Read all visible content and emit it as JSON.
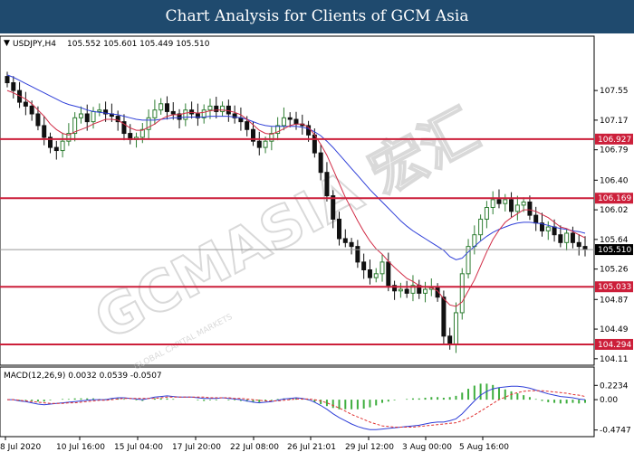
{
  "banner": {
    "title": "Chart Analysis for Clients of GCM Asia"
  },
  "watermark": {
    "text": "GCMASIA 宏汇",
    "subtext": "GLOBAL CAPITAL MARKETS",
    "color": "#cfcfcf"
  },
  "chart_data": [
    {
      "type": "candlestick",
      "symbol_label": "USDJPY,H4",
      "ohlc_label": "105.552 105.601 105.449 105.510",
      "ylim": [
        104.05,
        108.05
      ],
      "y_ticks": [
        107.55,
        107.17,
        106.79,
        106.4,
        106.02,
        105.64,
        105.26,
        104.87,
        104.49,
        104.11
      ],
      "x_ticks": [
        "8 Jul 2020",
        "10 Jul 16:00",
        "15 Jul 04:00",
        "17 Jul 20:00",
        "22 Jul 08:00",
        "26 Jul 21:01",
        "29 Jul 12:00",
        "3 Aug 00:00",
        "5 Aug 16:00"
      ],
      "levels": [
        {
          "value": 106.927,
          "label": "106.927"
        },
        {
          "value": 106.169,
          "label": "106.169"
        },
        {
          "value": 105.033,
          "label": "105.033"
        },
        {
          "value": 104.294,
          "label": "104.294"
        }
      ],
      "current_price": {
        "value": 105.51,
        "label": "105.510"
      },
      "colors": {
        "up": "#2e7d32",
        "down": "#111111",
        "level": "#cc1f3a",
        "ma_fast": "#d12b45",
        "ma_slow": "#2f3fd8",
        "current": "#999999"
      },
      "close": [
        107.65,
        107.55,
        107.4,
        107.35,
        107.25,
        107.1,
        106.95,
        106.82,
        106.78,
        106.9,
        107.0,
        107.2,
        107.25,
        107.15,
        107.28,
        107.3,
        107.25,
        107.22,
        107.15,
        107.0,
        106.92,
        106.95,
        107.05,
        107.2,
        107.3,
        107.38,
        107.28,
        107.25,
        107.18,
        107.3,
        107.25,
        107.2,
        107.3,
        107.35,
        107.28,
        107.35,
        107.25,
        107.2,
        107.15,
        107.05,
        106.9,
        106.82,
        106.9,
        107.0,
        107.1,
        107.2,
        107.18,
        107.12,
        107.1,
        106.98,
        106.75,
        106.5,
        106.2,
        105.9,
        105.65,
        105.6,
        105.55,
        105.35,
        105.25,
        105.15,
        105.2,
        105.35,
        105.05,
        104.98,
        105.0,
        104.95,
        105.05,
        104.95,
        105.0,
        105.02,
        104.9,
        104.4,
        104.3,
        104.7,
        105.2,
        105.55,
        105.7,
        105.9,
        106.05,
        106.15,
        106.1,
        106.15,
        106.0,
        106.08,
        106.12,
        105.95,
        105.85,
        105.75,
        105.8,
        105.7,
        105.6,
        105.72,
        105.6,
        105.55,
        105.51
      ],
      "ma_fast": [
        107.55,
        107.52,
        107.48,
        107.44,
        107.38,
        107.3,
        107.22,
        107.12,
        107.05,
        107.0,
        106.98,
        107.02,
        107.05,
        107.08,
        107.12,
        107.15,
        107.18,
        107.18,
        107.17,
        107.12,
        107.07,
        107.04,
        107.04,
        107.08,
        107.12,
        107.18,
        107.22,
        107.24,
        107.24,
        107.26,
        107.27,
        107.26,
        107.27,
        107.29,
        107.3,
        107.3,
        107.29,
        107.27,
        107.24,
        107.18,
        107.11,
        107.04,
        107.0,
        106.99,
        107.02,
        107.06,
        107.1,
        107.12,
        107.12,
        107.08,
        106.98,
        106.86,
        106.72,
        106.54,
        106.36,
        106.18,
        106.03,
        105.88,
        105.74,
        105.62,
        105.52,
        105.45,
        105.36,
        105.28,
        105.21,
        105.14,
        105.1,
        105.05,
        105.03,
        105.02,
        104.98,
        104.88,
        104.8,
        104.78,
        104.84,
        104.98,
        105.12,
        105.3,
        105.48,
        105.64,
        105.76,
        105.86,
        105.92,
        105.97,
        106.02,
        106.02,
        106.0,
        105.96,
        105.92,
        105.86,
        105.8,
        105.78,
        105.74,
        105.7,
        105.66
      ],
      "ma_slow": [
        107.75,
        107.72,
        107.68,
        107.64,
        107.6,
        107.56,
        107.52,
        107.48,
        107.44,
        107.4,
        107.37,
        107.35,
        107.33,
        107.3,
        107.28,
        107.27,
        107.26,
        107.25,
        107.24,
        107.22,
        107.2,
        107.18,
        107.17,
        107.17,
        107.17,
        107.18,
        107.19,
        107.2,
        107.2,
        107.21,
        107.21,
        107.21,
        107.21,
        107.22,
        107.22,
        107.22,
        107.22,
        107.21,
        107.2,
        107.18,
        107.15,
        107.12,
        107.1,
        107.09,
        107.09,
        107.09,
        107.09,
        107.09,
        107.08,
        107.06,
        107.02,
        106.97,
        106.9,
        106.82,
        106.73,
        106.64,
        106.55,
        106.46,
        106.37,
        106.28,
        106.2,
        106.12,
        106.04,
        105.96,
        105.88,
        105.81,
        105.75,
        105.7,
        105.65,
        105.6,
        105.55,
        105.5,
        105.42,
        105.38,
        105.4,
        105.48,
        105.55,
        105.62,
        105.68,
        105.73,
        105.77,
        105.8,
        105.83,
        105.85,
        105.86,
        105.86,
        105.85,
        105.84,
        105.82,
        105.8,
        105.78,
        105.77,
        105.75,
        105.74,
        105.72
      ]
    },
    {
      "type": "macd",
      "label": "MACD(12,26,9) 0.0032 0.0539 -0.0507",
      "ylim": [
        -0.55,
        0.27
      ],
      "y_ticks": [
        {
          "value": 0.2234,
          "label": "0.2234"
        },
        {
          "value": 0.0,
          "label": "0.00"
        },
        {
          "value": -0.4747,
          "label": "-0.4747"
        }
      ],
      "colors": {
        "hist": "#3fae3f",
        "macd": "#2f3fd8",
        "signal": "#e03030"
      },
      "macd": [
        0.0,
        0.0,
        -0.02,
        -0.03,
        -0.05,
        -0.07,
        -0.08,
        -0.07,
        -0.06,
        -0.05,
        -0.04,
        -0.03,
        -0.02,
        -0.01,
        0.0,
        0.0,
        0.0,
        0.02,
        0.03,
        0.03,
        0.02,
        0.01,
        0.0,
        0.02,
        0.04,
        0.05,
        0.06,
        0.05,
        0.04,
        0.04,
        0.04,
        0.03,
        0.02,
        0.02,
        0.02,
        0.03,
        0.02,
        0.01,
        0.0,
        -0.02,
        -0.04,
        -0.05,
        -0.04,
        -0.03,
        -0.01,
        0.01,
        0.02,
        0.03,
        0.02,
        0.0,
        -0.04,
        -0.09,
        -0.15,
        -0.22,
        -0.28,
        -0.33,
        -0.38,
        -0.42,
        -0.45,
        -0.47,
        -0.47,
        -0.46,
        -0.45,
        -0.44,
        -0.43,
        -0.42,
        -0.41,
        -0.4,
        -0.38,
        -0.36,
        -0.35,
        -0.35,
        -0.33,
        -0.3,
        -0.22,
        -0.12,
        -0.02,
        0.07,
        0.13,
        0.17,
        0.19,
        0.2,
        0.21,
        0.21,
        0.2,
        0.18,
        0.15,
        0.12,
        0.09,
        0.07,
        0.05,
        0.04,
        0.03,
        0.01,
        0.0
      ],
      "signal": [
        0.0,
        0.0,
        -0.01,
        -0.02,
        -0.03,
        -0.04,
        -0.05,
        -0.06,
        -0.06,
        -0.06,
        -0.05,
        -0.05,
        -0.04,
        -0.03,
        -0.02,
        -0.01,
        -0.01,
        0.0,
        0.01,
        0.02,
        0.02,
        0.02,
        0.02,
        0.02,
        0.02,
        0.03,
        0.04,
        0.04,
        0.04,
        0.04,
        0.04,
        0.04,
        0.04,
        0.03,
        0.03,
        0.03,
        0.03,
        0.02,
        0.02,
        0.01,
        0.0,
        -0.01,
        -0.02,
        -0.02,
        -0.02,
        -0.01,
        0.0,
        0.01,
        0.01,
        0.01,
        0.0,
        -0.02,
        -0.05,
        -0.09,
        -0.13,
        -0.18,
        -0.23,
        -0.27,
        -0.31,
        -0.35,
        -0.38,
        -0.41,
        -0.42,
        -0.43,
        -0.43,
        -0.43,
        -0.43,
        -0.42,
        -0.41,
        -0.4,
        -0.39,
        -0.38,
        -0.37,
        -0.36,
        -0.33,
        -0.29,
        -0.24,
        -0.18,
        -0.12,
        -0.06,
        0.0,
        0.04,
        0.08,
        0.11,
        0.13,
        0.14,
        0.14,
        0.14,
        0.13,
        0.12,
        0.11,
        0.1,
        0.08,
        0.07,
        0.05
      ]
    }
  ]
}
